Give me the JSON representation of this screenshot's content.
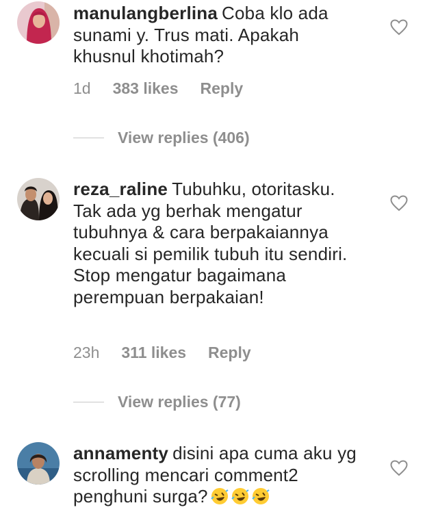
{
  "comments": [
    {
      "username": "manulangberlina",
      "text": "Coba  klo  ada sunami  y. Trus  mati. Apakah khusnul  khotimah?",
      "time": "1d",
      "likes": "383 likes",
      "reply": "Reply",
      "view_replies": "View replies (406)"
    },
    {
      "username": "reza_raline",
      "text": "Tubuhku, otoritasku. Tak ada yg berhak mengatur tubuhnya & cara berpakaiannya kecuali si pemilik tubuh itu sendiri. Stop mengatur bagaimana perempuan berpakaian!",
      "time": "23h",
      "likes": "311 likes",
      "reply": "Reply",
      "view_replies": "View replies (77)"
    },
    {
      "username": "annamenty",
      "text": "disini apa cuma aku yg scrolling mencari comment2 penghuni surga?"
    }
  ],
  "icons": {
    "like": "heart-outline-icon",
    "emoji": "rolling-on-floor-laughing-emoji"
  }
}
